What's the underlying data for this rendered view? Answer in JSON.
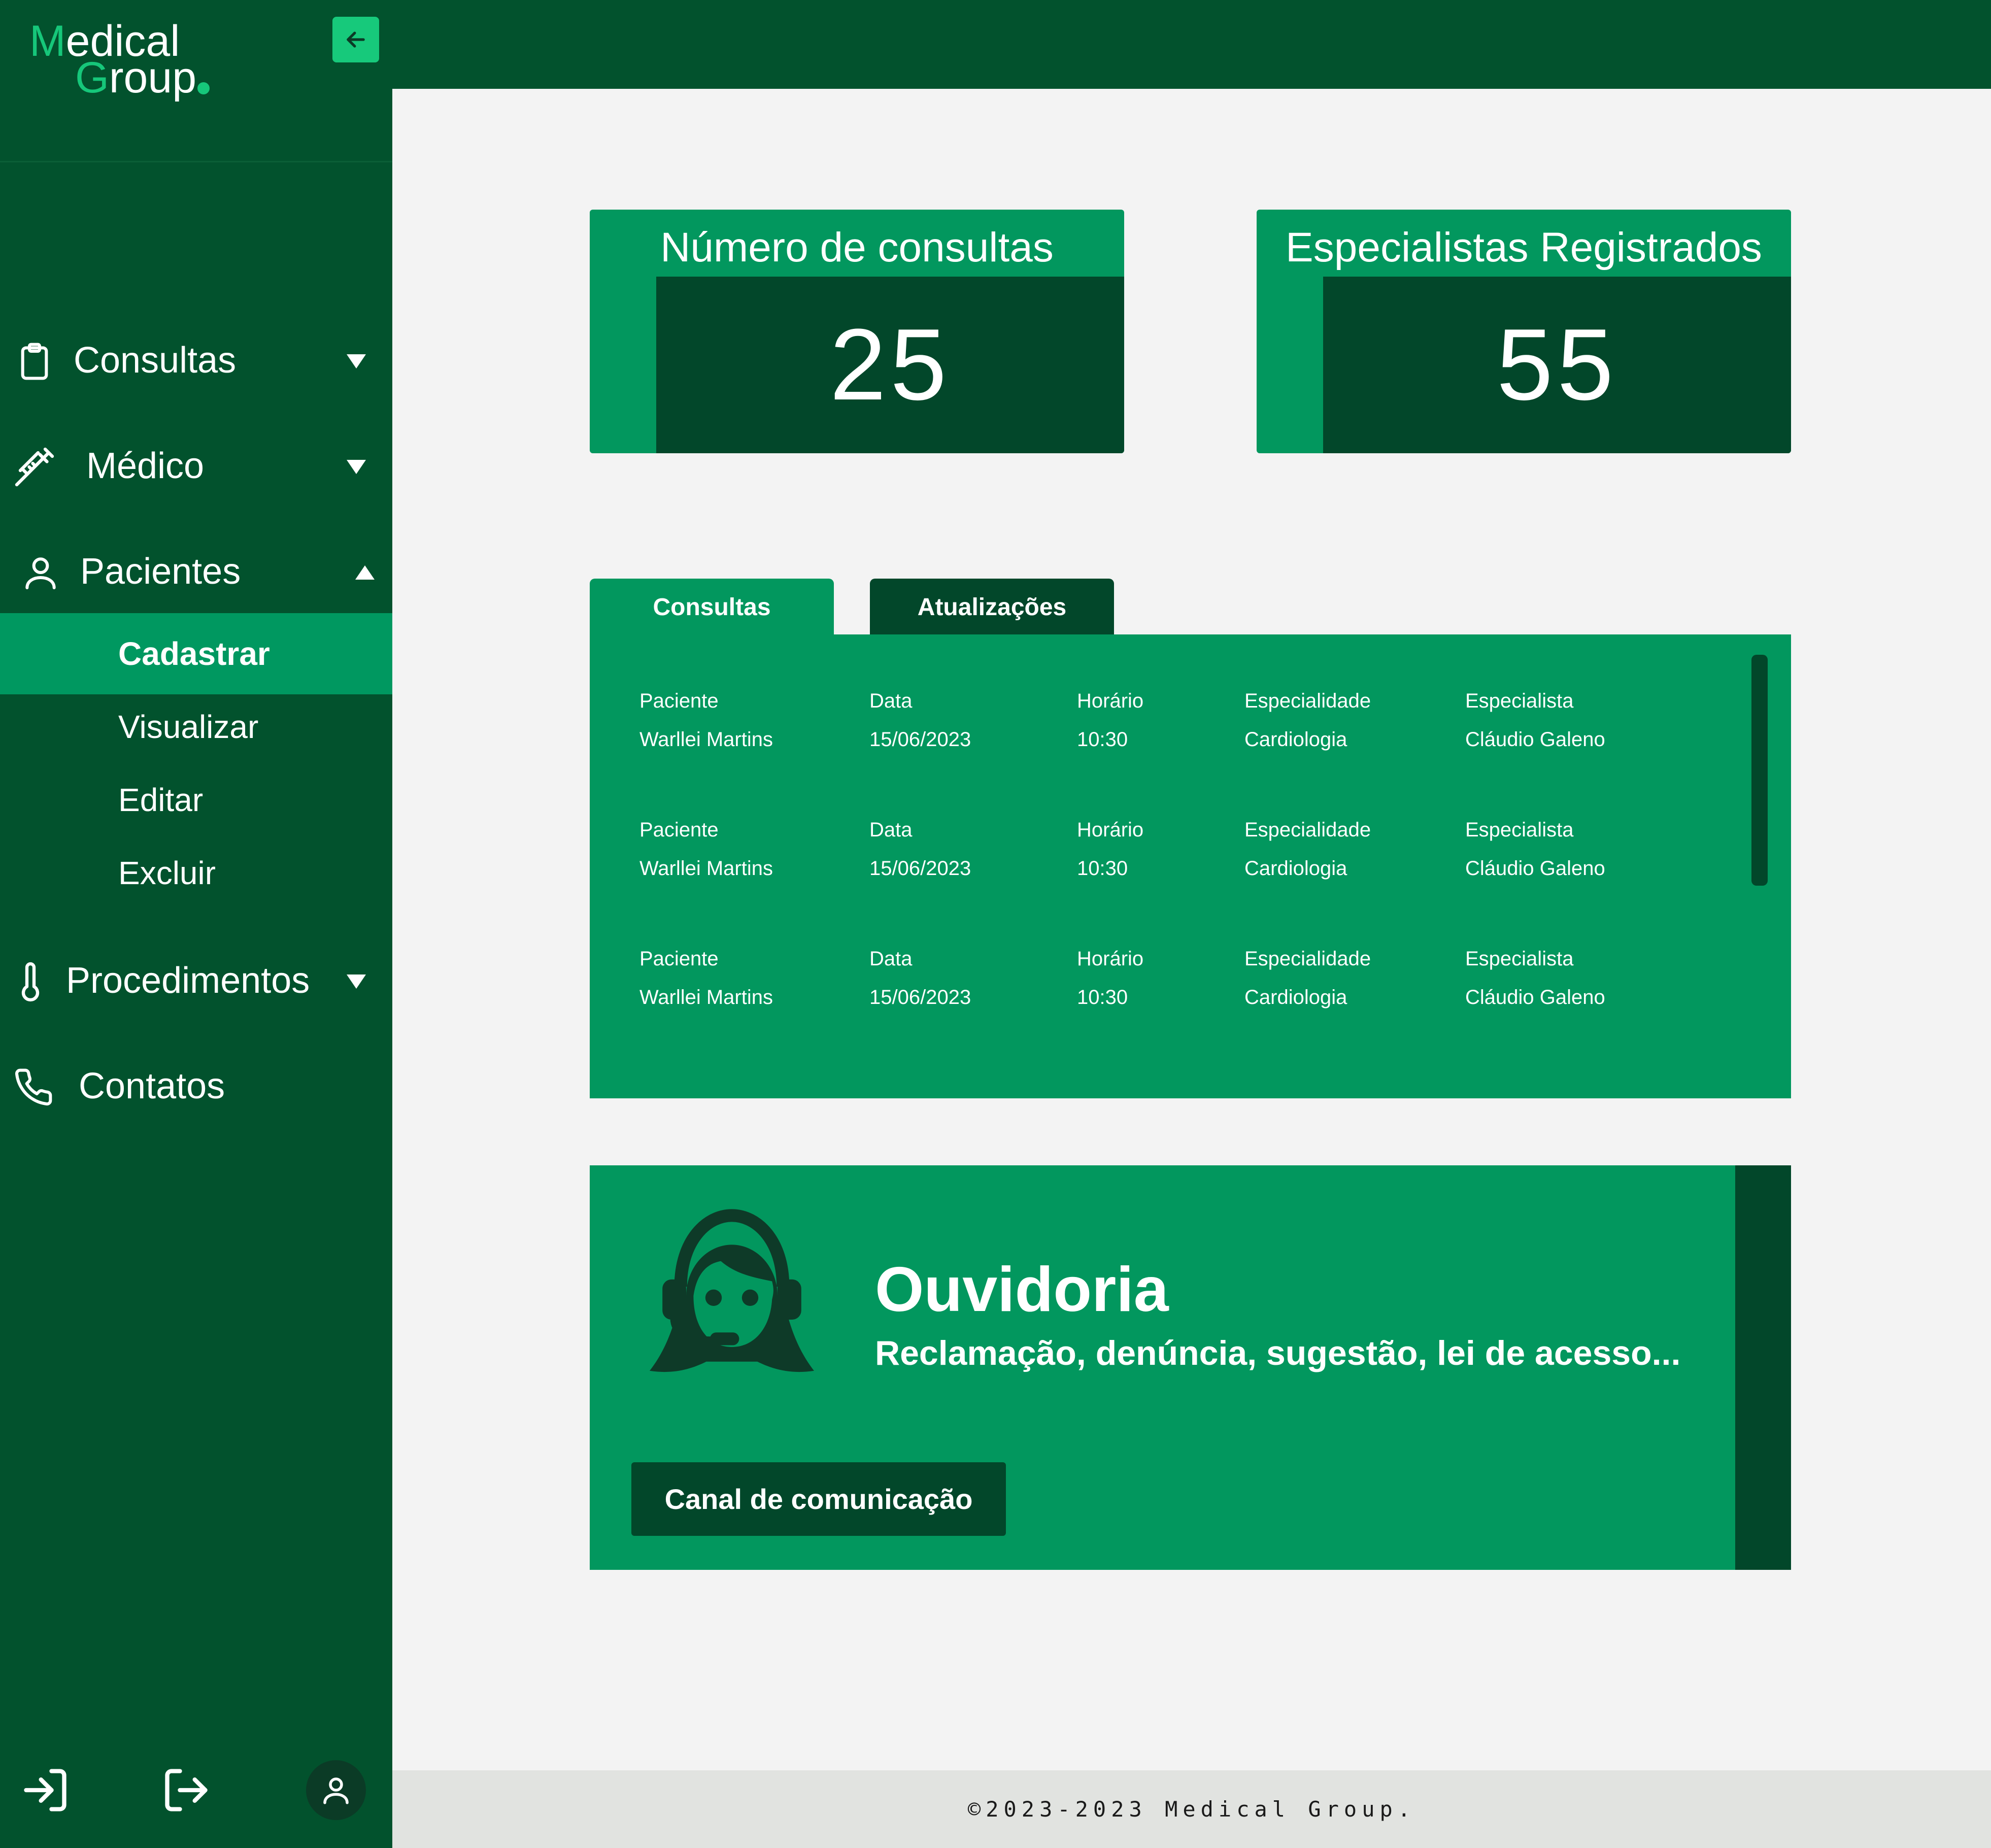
{
  "brand": {
    "line1_initial": "M",
    "line1_rest": "edical",
    "line2_initial": "G",
    "line2_rest": "roup",
    "colors": {
      "sidebar": "#02522d",
      "accent": "#16c77a",
      "card": "#02975e",
      "card_dark": "#02472a"
    }
  },
  "sidebar": {
    "collapse_icon": "arrow-left-icon",
    "items": [
      {
        "label": "Consultas",
        "icon": "clipboard-icon",
        "caret": "down"
      },
      {
        "label": "Médico",
        "icon": "syringe-icon",
        "caret": "down"
      },
      {
        "label": "Pacientes",
        "icon": "user-icon",
        "caret": "up"
      },
      {
        "label": "Procedimentos",
        "icon": "thermometer-icon",
        "caret": "down"
      },
      {
        "label": "Contatos",
        "icon": "phone-icon"
      }
    ],
    "pacientes_sub": [
      "Cadastrar",
      "Visualizar",
      "Editar",
      "Excluir"
    ],
    "active_sub": "Cadastrar",
    "bottom_icons": [
      "login-icon",
      "logout-icon",
      "avatar-icon"
    ]
  },
  "stats": [
    {
      "title": "Número de consultas",
      "value": "25"
    },
    {
      "title": "Especialistas Registrados",
      "value": "55"
    }
  ],
  "tabs": [
    {
      "label": "Consultas",
      "active": true
    },
    {
      "label": "Atualizações",
      "active": false
    }
  ],
  "table": {
    "headers": [
      "Paciente",
      "Data",
      "Horário",
      "Especialidade",
      "Especialista"
    ],
    "rows": [
      [
        "Warllei Martins",
        "15/06/2023",
        "10:30",
        "Cardiologia",
        "Cláudio Galeno"
      ],
      [
        "Warllei Martins",
        "15/06/2023",
        "10:30",
        "Cardiologia",
        "Cláudio Galeno"
      ],
      [
        "Warllei Martins",
        "15/06/2023",
        "10:30",
        "Cardiologia",
        "Cláudio Galeno"
      ]
    ]
  },
  "ouvidoria": {
    "icon": "support-agent-icon",
    "title": "Ouvidoria",
    "subtitle": "Reclamação, denúncia, sugestão, lei de acesso...",
    "button": "Canal de comunicação"
  },
  "footer": {
    "text": "©2023-2023 Medical Group."
  }
}
